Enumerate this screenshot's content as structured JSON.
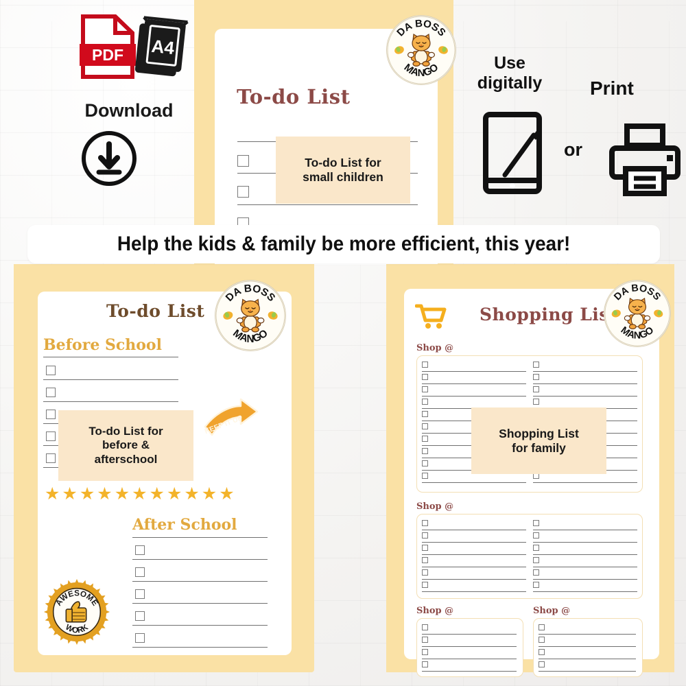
{
  "banner": {
    "text": "Help the kids & family be more efficient, this year!"
  },
  "brand": {
    "top_text": "DA BOSS",
    "bottom_text": "MANGO",
    "mascot": "meditating-cat",
    "fruit": "mango"
  },
  "promo": {
    "pdf_badge": "PDF",
    "a4_badge": "A4",
    "download_label": "Download",
    "use_digitally_label": "Use\ndigitally",
    "use_digitally_line1": "Use",
    "use_digitally_line2": "digitally",
    "or_label": "or",
    "print_label": "Print",
    "icons": {
      "download": "download-circle-icon",
      "tablet": "tablet-stylus-icon",
      "printer": "printer-icon",
      "pdf": "pdf-file-icon",
      "a4": "a4-paper-icon"
    }
  },
  "previews": [
    {
      "id": "todo-small-children",
      "title": "To-do List",
      "title_color": "#8C4A47",
      "tag_line1": "To-do List for",
      "tag_line2": "small children",
      "checkbox_rows": 6
    },
    {
      "id": "todo-before-after-school",
      "title": "To-do List",
      "title_color": "#6E4C2C",
      "sections": [
        {
          "heading": "Before School",
          "rows": 5
        },
        {
          "heading": "After School",
          "rows": 5
        }
      ],
      "tag_line1": "To-do List for",
      "tag_line2": "before &",
      "tag_line3": "afterschool",
      "arrow_sticker": "KEEP IT UP",
      "badge_top": "AWESOME",
      "badge_bottom": "WORK",
      "badge_icon": "thumbs-up-icon",
      "stars": 11,
      "star_color": "#F3B32A"
    },
    {
      "id": "shopping-list-family",
      "title": "Shopping List",
      "title_color": "#8C4A47",
      "cart_icon": "shopping-cart-icon",
      "cart_color": "#F5AF1E",
      "shop_label": "Shop @",
      "tag_line1": "Shopping List",
      "tag_line2": "for family",
      "blocks": [
        {
          "label": "Shop @",
          "rows": 10,
          "cols": 2
        },
        {
          "label": "Shop @",
          "rows": 6,
          "cols": 2
        },
        {
          "label": "Shop @",
          "rows": 4,
          "cols": 1
        },
        {
          "label": "Shop @",
          "rows": 4,
          "cols": 1
        }
      ]
    }
  ],
  "colors": {
    "panel_yellow": "#FAE1A5",
    "tag_peach": "#FAE7CA",
    "maroon": "#8C4A47",
    "brown": "#6E4C2C",
    "amber": "#E2A93F",
    "pdf_red": "#D10A1C",
    "ink": "#111111",
    "rule": "#6f6f6f"
  }
}
